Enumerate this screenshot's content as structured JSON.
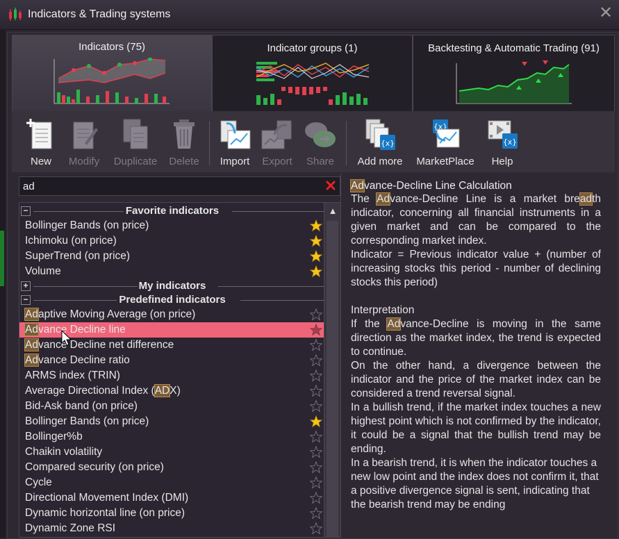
{
  "window": {
    "title": "Indicators & Trading systems"
  },
  "tabs": [
    {
      "label": "Indicators (75)"
    },
    {
      "label": "Indicator groups (1)"
    },
    {
      "label": "Backtesting & Automatic Trading (91)"
    }
  ],
  "toolbar": {
    "new": "New",
    "modify": "Modify",
    "duplicate": "Duplicate",
    "delete": "Delete",
    "import": "Import",
    "export": "Export",
    "share": "Share",
    "add_more": "Add more",
    "marketplace": "MarketPlace",
    "help": "Help"
  },
  "search": {
    "value": "ad"
  },
  "groups": {
    "favorite": "Favorite indicators",
    "my": "My indicators",
    "predefined": "Predefined indicators"
  },
  "favorites": [
    "Bollinger Bands (on price)",
    "Ichimoku (on price)",
    "SuperTrend (on price)",
    "Volume"
  ],
  "predefined": [
    {
      "pre": "",
      "hl": "Ad",
      "post": "aptive Moving Average (on price)"
    },
    {
      "pre": "",
      "hl": "Ad",
      "post": "vance Decline line"
    },
    {
      "pre": "",
      "hl": "Ad",
      "post": "vance Decline net difference"
    },
    {
      "pre": "",
      "hl": "Ad",
      "post": "vance Decline ratio"
    },
    {
      "pre": "ARMS index (TRIN)",
      "hl": "",
      "post": ""
    },
    {
      "pre": "Average Directional Index (",
      "hl": "AD",
      "post": "X)"
    },
    {
      "pre": "Bid-Ask band (on price)",
      "hl": "",
      "post": ""
    },
    {
      "pre": "Bollinger Bands (on price)",
      "hl": "",
      "post": ""
    },
    {
      "pre": "Bollinger%b",
      "hl": "",
      "post": ""
    },
    {
      "pre": "Chaikin volatility",
      "hl": "",
      "post": ""
    },
    {
      "pre": "Compared security (on price)",
      "hl": "",
      "post": ""
    },
    {
      "pre": "Cycle",
      "hl": "",
      "post": ""
    },
    {
      "pre": "Directional Movement Index (DMI)",
      "hl": "",
      "post": ""
    },
    {
      "pre": "Dynamic horizontal line (on price)",
      "hl": "",
      "post": ""
    },
    {
      "pre": "Dynamic Zone RSI",
      "hl": "",
      "post": ""
    }
  ],
  "description": {
    "title_hl": "Ad",
    "title_rest": "vance-Decline Line Calculation",
    "p1_a": "The ",
    "p1_hl1": "Ad",
    "p1_b": "vance-Decline Line is a market bre",
    "p1_hl2": "ad",
    "p1_c": "th indicator, concerning all financial instruments in a given market and can be compared to the corresponding market index.",
    "p2": "Indicator = Previous indicator value + (number of increasing stocks this period - number of declining stocks this period)",
    "interp": "Interpretation",
    "p3_a": "If the ",
    "p3_hl": "Ad",
    "p3_b": "vance-Decline is moving in the same direction as the market index, the trend is expected to continue.",
    "p4": "On the other hand, a divergence between the indicator and the price of the market index can be considered a trend reversal signal.",
    "p5": "In a bullish trend, if the market index touches a new highest point which is not confirmed by the indicator, it could be a signal that the bullish trend may be ending.",
    "p6": "In a bearish trend, it is when the indicator touches a new low point and the index does not confirm it, that a positive divergence signal is sent, indicating that the bearish trend may be ending"
  },
  "colors": {
    "selected_row": "#f06479",
    "highlight": "#7a5c37",
    "star_gold": "#f5c518"
  }
}
